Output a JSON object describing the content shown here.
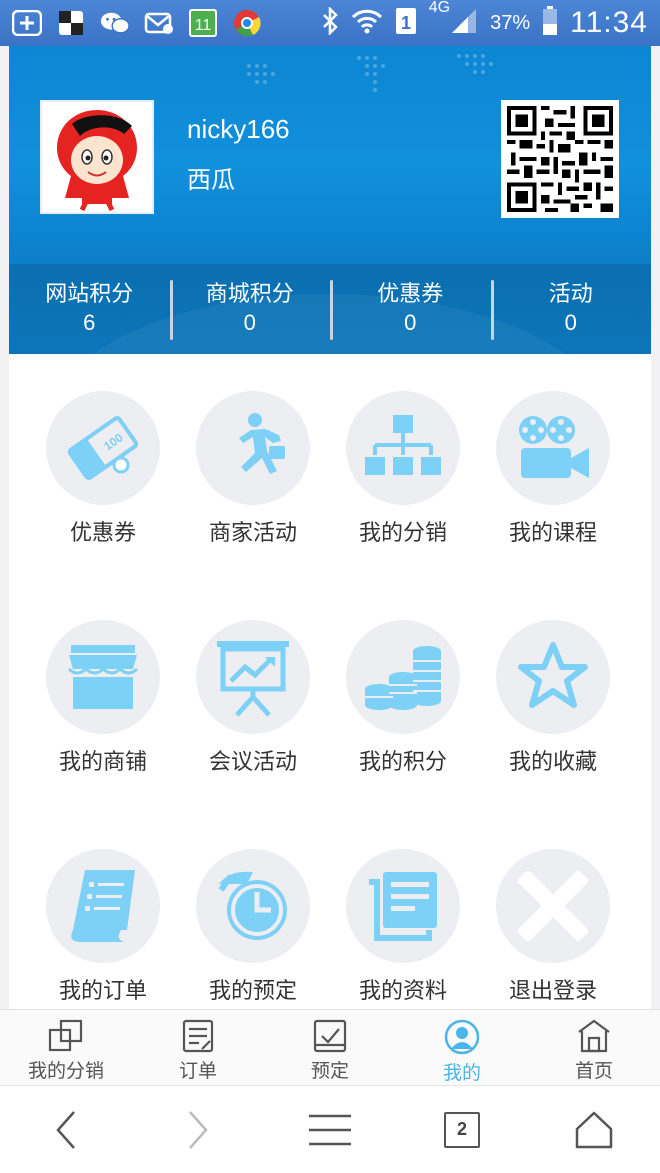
{
  "status_bar": {
    "network": "4G",
    "battery": "37%",
    "time": "11:34",
    "left_icons": [
      "add-icon",
      "app-icon",
      "wechat-icon",
      "mail-icon",
      "calendar-icon",
      "chrome-icon"
    ],
    "right_icons": [
      "bluetooth-icon",
      "wifi-icon",
      "sim-icon",
      "signal-icon",
      "battery-icon"
    ]
  },
  "profile": {
    "username": "nicky166",
    "nickname": "西瓜"
  },
  "stats": [
    {
      "label": "网站积分",
      "value": "6"
    },
    {
      "label": "商城积分",
      "value": "0"
    },
    {
      "label": "优惠券",
      "value": "0"
    },
    {
      "label": "活动",
      "value": "0"
    }
  ],
  "menu": [
    {
      "label": "优惠券",
      "icon": "coupon-icon"
    },
    {
      "label": "商家活动",
      "icon": "running-man-icon"
    },
    {
      "label": "我的分销",
      "icon": "org-chart-icon"
    },
    {
      "label": "我的课程",
      "icon": "video-camera-icon"
    },
    {
      "label": "我的商铺",
      "icon": "shop-icon"
    },
    {
      "label": "会议活动",
      "icon": "presentation-icon"
    },
    {
      "label": "我的积分",
      "icon": "coins-icon"
    },
    {
      "label": "我的收藏",
      "icon": "star-icon"
    },
    {
      "label": "我的订单",
      "icon": "order-list-icon"
    },
    {
      "label": "我的预定",
      "icon": "clock-icon"
    },
    {
      "label": "我的资料",
      "icon": "document-icon"
    },
    {
      "label": "退出登录",
      "icon": "close-icon"
    }
  ],
  "tabbar": [
    {
      "label": "我的分销",
      "icon": "distribution-icon",
      "active": false
    },
    {
      "label": "订单",
      "icon": "order-icon",
      "active": false
    },
    {
      "label": "预定",
      "icon": "reserve-icon",
      "active": false
    },
    {
      "label": "我的",
      "icon": "user-icon",
      "active": true
    },
    {
      "label": "首页",
      "icon": "home-icon",
      "active": false
    }
  ],
  "system_nav": {
    "tab_count": "2"
  },
  "colors": {
    "header_blue": "#1190dc",
    "stats_blue": "#0c75b9",
    "icon_blue": "#7dd0f6",
    "active_tab": "#49b5ea"
  }
}
